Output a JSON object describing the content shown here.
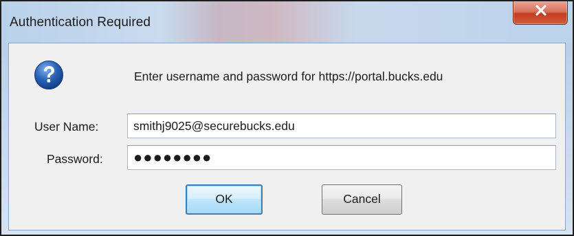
{
  "window": {
    "title": "Authentication Required",
    "close_icon": "close-x-icon"
  },
  "dialog": {
    "icon": "question-icon",
    "message": "Enter username and password for https://portal.bucks.edu"
  },
  "fields": {
    "username_label": "User Name:",
    "username_value": "smithj9025@securebucks.edu",
    "password_label": "Password:",
    "password_value": "●●●●●●●●"
  },
  "buttons": {
    "ok_label": "OK",
    "cancel_label": "Cancel"
  },
  "colors": {
    "accent": "#3c7fb1",
    "close_button": "#c23c20",
    "question_icon": "#2a62b6"
  }
}
